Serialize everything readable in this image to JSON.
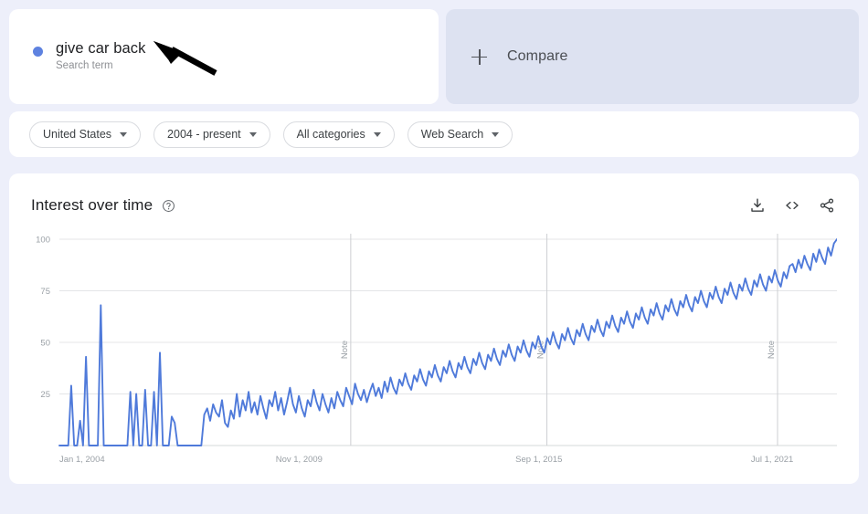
{
  "search_term": {
    "title": "give car back",
    "subtitle": "Search term",
    "dot_color": "#5e82e0"
  },
  "compare": {
    "label": "Compare",
    "plus_icon": "plus-icon",
    "background": "#dde2f1"
  },
  "annotation": {
    "type": "arrow",
    "color": "#000000"
  },
  "filters": [
    {
      "label": "United States",
      "icon": "chevron-down-icon"
    },
    {
      "label": "2004 - present",
      "icon": "chevron-down-icon"
    },
    {
      "label": "All categories",
      "icon": "chevron-down-icon"
    },
    {
      "label": "Web Search",
      "icon": "chevron-down-icon"
    }
  ],
  "chart_card": {
    "title": "Interest over time",
    "help_icon": "help-circle-icon",
    "actions": [
      {
        "name": "download-icon",
        "label": "Download"
      },
      {
        "name": "embed-icon",
        "label": "Embed"
      },
      {
        "name": "share-icon",
        "label": "Share"
      }
    ]
  },
  "chart_data": {
    "type": "line",
    "title": "Interest over time",
    "xlabel": "",
    "ylabel": "",
    "ylim": [
      0,
      100
    ],
    "yticks": [
      25,
      50,
      75,
      100
    ],
    "ytick_labels": [
      "25",
      "50",
      "75",
      "100"
    ],
    "xtick_labels": [
      "Jan 1, 2004",
      "Nov 1, 2009",
      "Sep 1, 2015",
      "Jul 1, 2021"
    ],
    "xtick_positions": [
      0,
      0.3083,
      0.6167,
      0.9167
    ],
    "grid": true,
    "legend": false,
    "line_color": "#4f7ada",
    "series_name": "give car back",
    "annotations": [
      {
        "label": "Note",
        "x_fraction": 0.3747
      },
      {
        "label": "Note",
        "x_fraction": 0.627
      },
      {
        "label": "Note",
        "x_fraction": 0.9236
      }
    ],
    "values": [
      0,
      0,
      0,
      0,
      29,
      0,
      0,
      12,
      0,
      43,
      0,
      0,
      0,
      0,
      68,
      0,
      0,
      0,
      0,
      0,
      0,
      0,
      0,
      0,
      26,
      0,
      25,
      0,
      0,
      27,
      0,
      0,
      26,
      0,
      45,
      0,
      0,
      0,
      14,
      11,
      0,
      0,
      0,
      0,
      0,
      0,
      0,
      0,
      0,
      15,
      18,
      12,
      20,
      16,
      14,
      22,
      11,
      9,
      17,
      13,
      25,
      14,
      22,
      17,
      26,
      16,
      21,
      15,
      24,
      18,
      13,
      22,
      19,
      26,
      17,
      23,
      15,
      21,
      28,
      20,
      16,
      24,
      18,
      14,
      22,
      19,
      27,
      21,
      17,
      25,
      20,
      16,
      23,
      18,
      26,
      22,
      19,
      28,
      24,
      20,
      30,
      25,
      22,
      27,
      21,
      26,
      30,
      24,
      28,
      23,
      31,
      26,
      33,
      28,
      25,
      32,
      29,
      35,
      30,
      27,
      34,
      31,
      37,
      32,
      29,
      36,
      33,
      39,
      34,
      31,
      38,
      35,
      41,
      36,
      33,
      40,
      37,
      43,
      38,
      35,
      42,
      39,
      45,
      40,
      37,
      44,
      41,
      47,
      42,
      39,
      46,
      43,
      49,
      44,
      41,
      48,
      45,
      51,
      46,
      43,
      50,
      47,
      53,
      48,
      45,
      52,
      49,
      55,
      50,
      47,
      54,
      51,
      57,
      52,
      49,
      56,
      53,
      59,
      54,
      51,
      58,
      55,
      61,
      56,
      53,
      60,
      57,
      63,
      58,
      55,
      62,
      59,
      65,
      60,
      57,
      64,
      61,
      67,
      62,
      59,
      66,
      63,
      69,
      64,
      61,
      68,
      65,
      71,
      66,
      63,
      70,
      67,
      73,
      68,
      65,
      72,
      69,
      75,
      70,
      67,
      74,
      71,
      77,
      72,
      69,
      76,
      73,
      79,
      74,
      71,
      78,
      75,
      81,
      76,
      73,
      80,
      77,
      83,
      78,
      75,
      82,
      79,
      85,
      80,
      77,
      84,
      81,
      87,
      88,
      84,
      90,
      86,
      92,
      88,
      85,
      93,
      89,
      95,
      91,
      88,
      96,
      92,
      98,
      100
    ]
  }
}
